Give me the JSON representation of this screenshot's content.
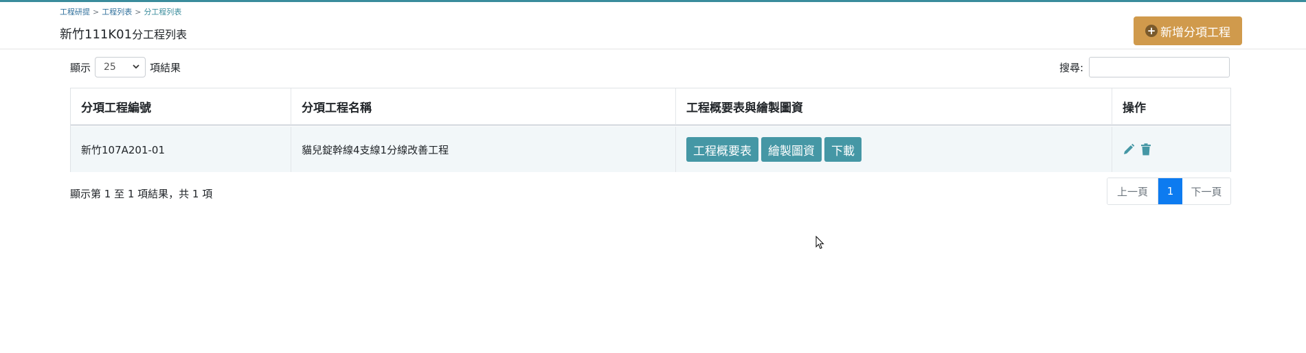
{
  "breadcrumb": {
    "items": [
      "工程研提",
      "工程列表",
      "分工程列表"
    ],
    "separator": ">"
  },
  "page": {
    "title_main": "新竹111K01",
    "title_suffix": "分工程列表"
  },
  "actions": {
    "add_label": "新增分項工程",
    "add_icon": "plus-circle-icon"
  },
  "length_control": {
    "prefix": "顯示",
    "value": "25",
    "suffix": "項結果"
  },
  "search": {
    "label": "搜尋:",
    "value": ""
  },
  "table": {
    "headers": [
      "分項工程編號",
      "分項工程名稱",
      "工程概要表與繪製圖資",
      "操作"
    ],
    "rows": [
      {
        "code": "新竹107A201-01",
        "name": "貓兒錠幹線4支線1分線改善工程",
        "buttons": [
          "工程概要表",
          "繪製圖資",
          "下載"
        ]
      }
    ]
  },
  "info": {
    "text": "顯示第 1 至 1 項結果，共 1 項"
  },
  "pagination": {
    "prev": "上一頁",
    "current": "1",
    "next": "下一頁"
  },
  "colors": {
    "accent_teal": "#4597a5",
    "add_button": "#d09a4c",
    "page_active": "#0d7bf0"
  }
}
